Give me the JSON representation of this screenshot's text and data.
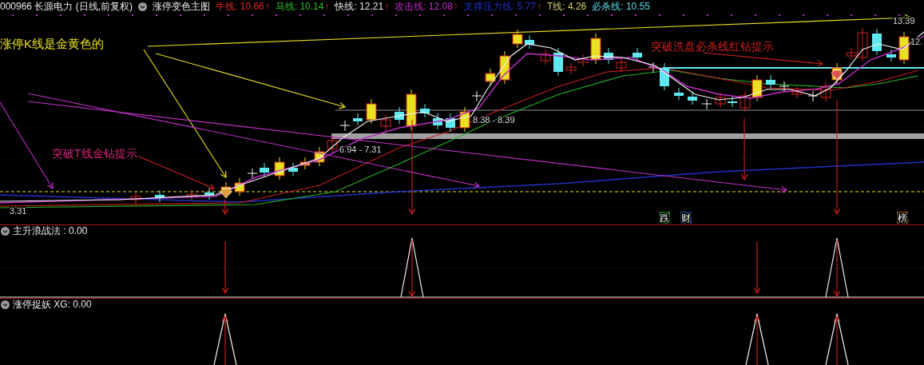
{
  "header": {
    "symbol": "000966 长源电力 (日线,前复权)",
    "indicator": "涨停变色主图",
    "legend": [
      {
        "name": "牛线:",
        "value": "10.66",
        "arrow": "↑",
        "color": "#e02828"
      },
      {
        "name": "马线:",
        "value": "10.14",
        "arrow": "↑",
        "color": "#28c028"
      },
      {
        "name": "快线:",
        "value": "12.21",
        "arrow": "↑",
        "color": "#e8e8e8"
      },
      {
        "name": "攻击线:",
        "value": "12.08",
        "arrow": "↑",
        "color": "#c030c8"
      },
      {
        "name": "支撑压力线:",
        "value": "5.77",
        "arrow": "↑",
        "color": "#2030c0"
      },
      {
        "name": "T线:",
        "value": "4.26",
        "color": "#d8d070"
      },
      {
        "name": "必杀线:",
        "value": "10.55",
        "color": "#60d8e8"
      }
    ]
  },
  "main_chart": {
    "notes": [
      {
        "text": "涨停K线是金黄色的",
        "color": "#e8e020"
      },
      {
        "text": "突破T线金钻提示",
        "color": "#d82878"
      },
      {
        "text": "突破洗盘必杀线红钻提示",
        "color": "#d02020"
      }
    ],
    "price_labels": [
      "13.39",
      "12.",
      "8.38 - 8.39",
      "6.94 - 7.31",
      "3.31"
    ],
    "badges": [
      {
        "text": "跌",
        "color": "#1c7a1c"
      },
      {
        "text": "财",
        "color": "#1c3c70"
      },
      {
        "text": "榜",
        "color": "#7a5020"
      }
    ]
  },
  "panels": [
    {
      "title": "主升浪战法 : 0.00"
    },
    {
      "title": "涨停捉妖  XG: 0.00"
    }
  ]
}
